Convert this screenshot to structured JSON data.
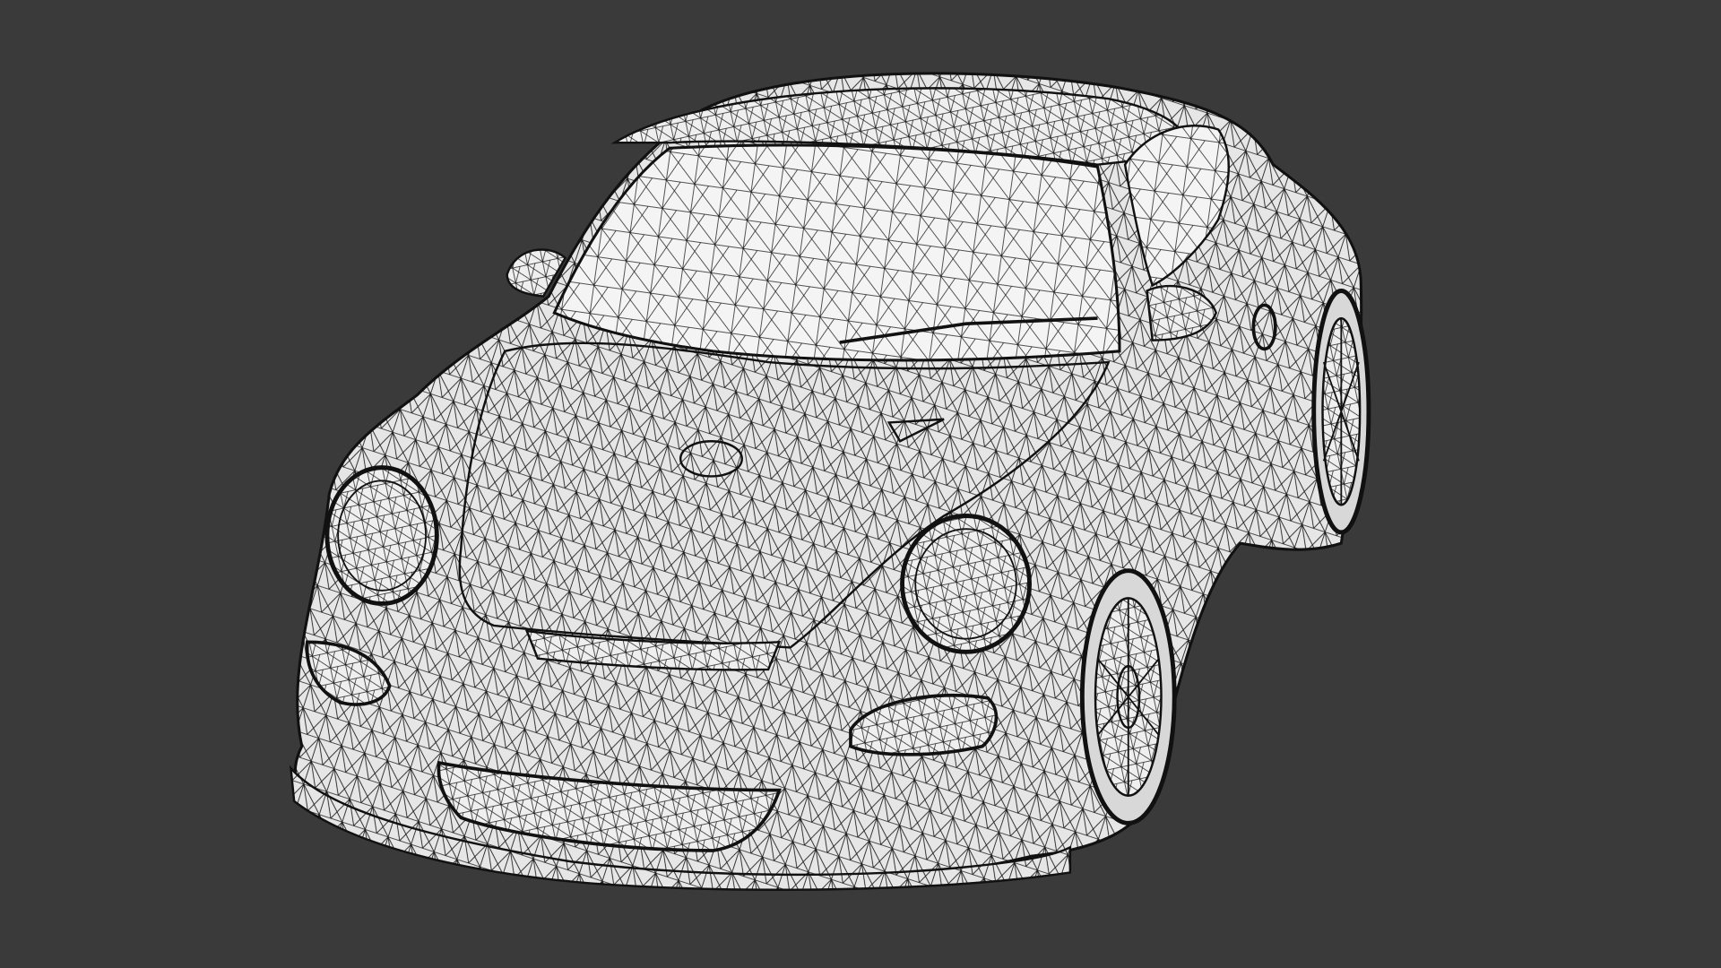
{
  "viewport": {
    "background_color": "#3a3a3a",
    "render_mode": "wireframe"
  },
  "model": {
    "kind": "sports-car-icon",
    "surface_color": "#e6e6e6",
    "wire_color": "#111111"
  }
}
